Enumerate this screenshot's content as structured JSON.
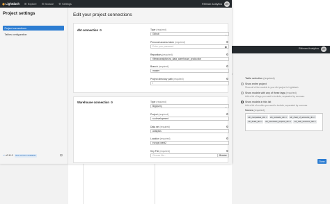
{
  "background": {
    "brand": "Rittman Analytics",
    "avatar": "MR",
    "table_selection": {
      "title_main": "Table selection",
      "title_req": "(required)",
      "options": [
        {
          "label": "Show entire project",
          "help": "Show all of the models in your dbt project in Lightdash.",
          "selected": false
        },
        {
          "label": "Show models with any of these tags",
          "req": "(required)",
          "help": "Add a list of tags you want to include, separated by commas.",
          "selected": false
        },
        {
          "label": "Show models in this list",
          "help": "Add a list of models you want to include, separated by commas.",
          "selected": true
        }
      ],
      "names_label": "Names",
      "names_req": "(required)",
      "tags": [
        "wh_companies_dim",
        "wh_contacts_dim",
        "wh_chart_of_accounts_dim",
        "wh_deals_fact",
        "wh_timesheet_projects_dim",
        "wh_web_sessions_fact"
      ]
    },
    "done_label": "Done"
  },
  "window": {
    "nav": {
      "logo": "Lightdash",
      "items": [
        {
          "icon": "⊞",
          "label": "Explore"
        },
        {
          "icon": "⊟",
          "label": "Browse"
        },
        {
          "icon": "⚙",
          "label": "Settings"
        }
      ],
      "brand": "Rittman Analytics",
      "avatar": "MR"
    },
    "sidebar": {
      "title": "Project settings",
      "items": [
        {
          "label": "Project connections",
          "active": true
        },
        {
          "label": "Tables configuration",
          "active": false
        }
      ],
      "version": "v0.11.0",
      "version_badge": "New version available"
    },
    "main": {
      "title": "Edit your project connections",
      "dbt": {
        "title": "dbt connection",
        "fields": {
          "type_label": "Type",
          "type_req": "(required)",
          "type_value": "Github",
          "token_label": "Personal access token",
          "token_req": "(required)",
          "token_placeholder": "Enter your password",
          "repo_label": "Repository",
          "repo_req": "(required)",
          "repo_value": "rittmananalytics/ra_data_warehouse_production",
          "branch_label": "Branch",
          "branch_req": "(required)",
          "branch_value": "master",
          "path_label": "Project directory path",
          "path_req": "(required)",
          "path_value": "/"
        }
      },
      "warehouse": {
        "title": "Warehouse connection",
        "fields": {
          "type_label": "Type",
          "type_req": "(required)",
          "type_value": "BigQuery",
          "project_label": "Project",
          "project_req": "(required)",
          "project_value": "ra-development",
          "dataset_label": "Data set",
          "dataset_req": "(required)",
          "dataset_value": "analytics",
          "location_label": "Location",
          "location_req": "(required)",
          "location_value": "europe-west2",
          "keyfile_label": "Key File",
          "keyfile_req": "(required)",
          "keyfile_placeholder": "Choose file...",
          "browse_label": "Browse"
        }
      }
    }
  }
}
